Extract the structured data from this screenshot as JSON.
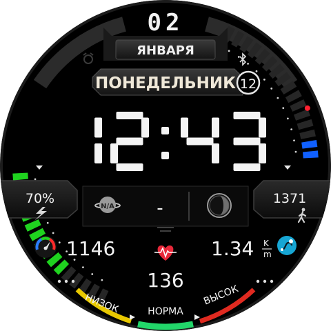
{
  "colors": {
    "background": "#000000",
    "accent_green": "#1fd31f",
    "accent_blue": "#1060ff",
    "accent_red": "#ff2030",
    "zone_low": "#e8c800",
    "zone_normal": "#22d66a",
    "zone_high": "#e02a20"
  },
  "date": {
    "day": "02",
    "month": "ЯНВАРЯ",
    "weekday": "ПОНЕДЕЛЬНИК",
    "week_number": "12"
  },
  "time": {
    "hours": "12",
    "minutes": "43"
  },
  "battery": {
    "label": "70%",
    "value": 0.7,
    "icon": "bolt-icon"
  },
  "steps": {
    "value": "1371",
    "icon": "walking-person-icon"
  },
  "weather": {
    "label": "N/A",
    "temperature": "-",
    "icon": "weather-na-icon"
  },
  "moon": {
    "icon": "moon-phase-icon"
  },
  "calories": {
    "value": "1146",
    "icon": "calorie-gauge-icon"
  },
  "distance": {
    "value": "1.34",
    "unit_top": "K",
    "unit_bottom": "m",
    "icon": "distance-icon"
  },
  "heart": {
    "value": "136",
    "icon": "heart-pulse-icon"
  },
  "zones": {
    "low": "НИЗОК",
    "normal": "НОРМА",
    "high": "ВЫСОК"
  },
  "status_icons": {
    "bluetooth": "bluetooth-icon",
    "alarm": "alarm-icon"
  }
}
